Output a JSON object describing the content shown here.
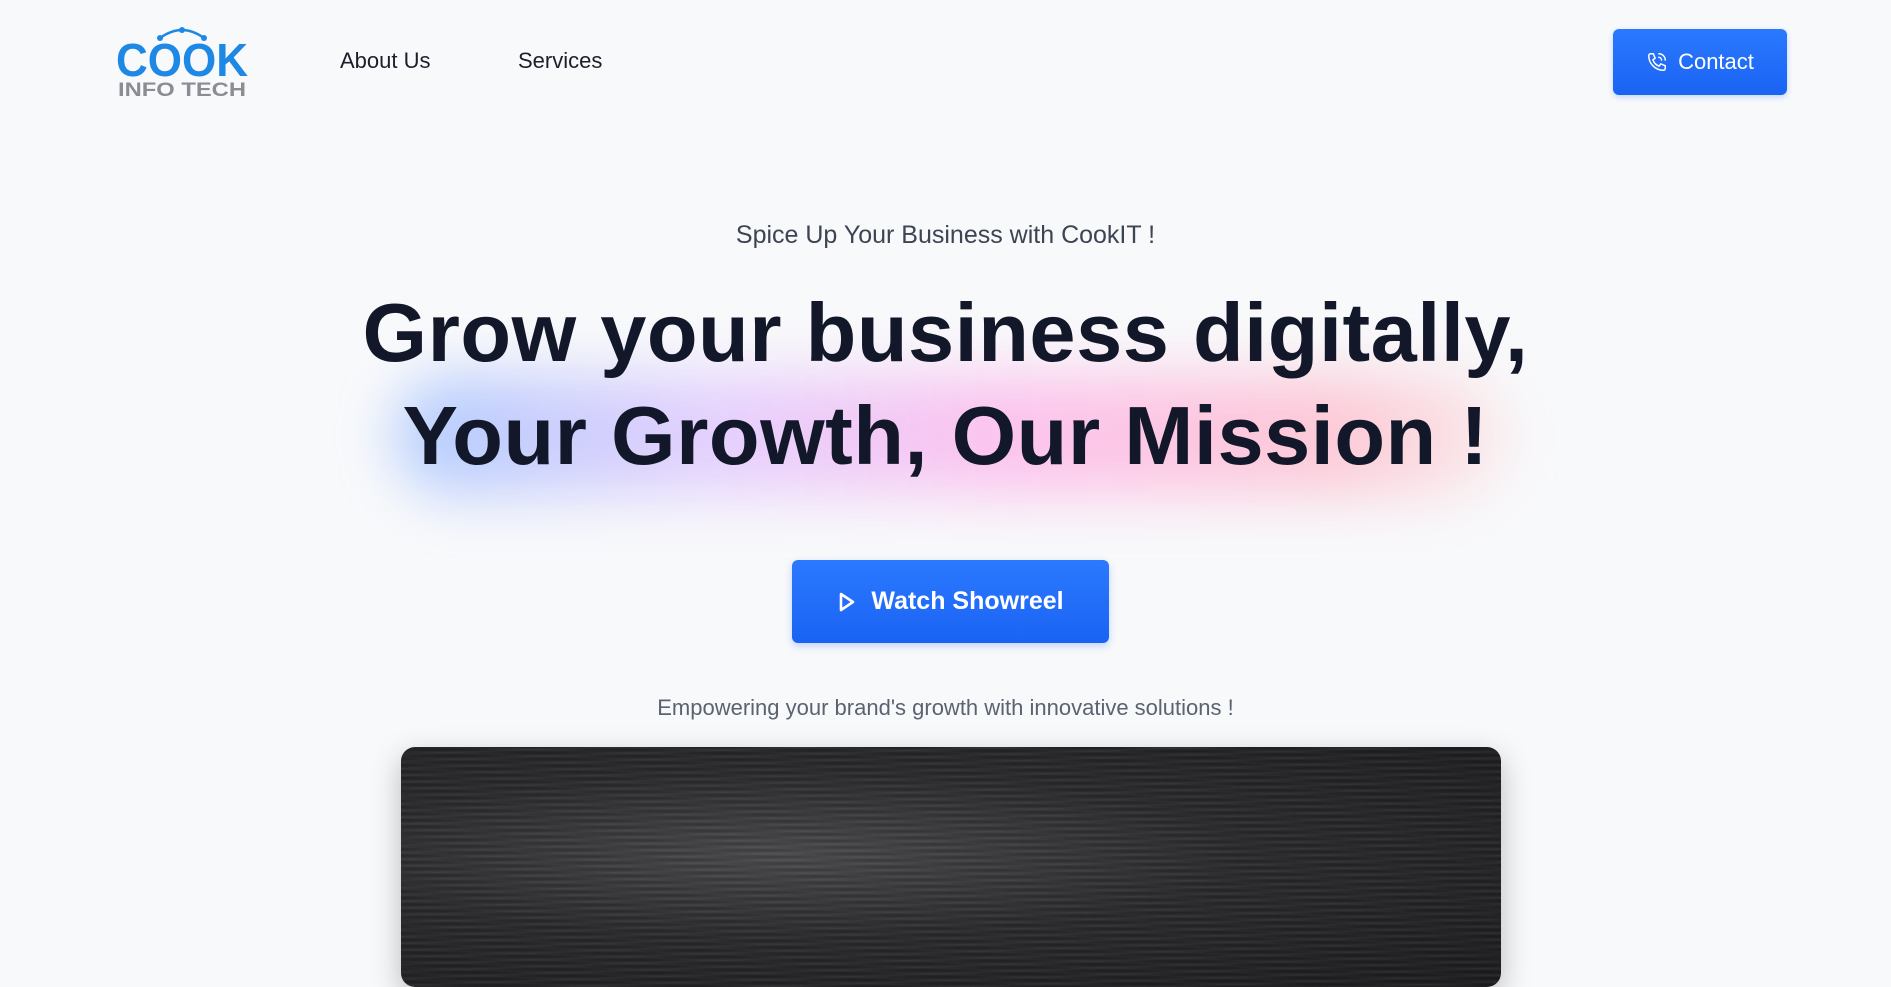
{
  "header": {
    "logo": {
      "top_text": "COOK",
      "bottom_text": "INFO TECH"
    },
    "nav": [
      {
        "label": "About Us"
      },
      {
        "label": "Services"
      }
    ],
    "contact_label": "Contact"
  },
  "hero": {
    "tagline": "Spice Up Your Business with CookIT !",
    "headline_line1": "Grow your business digitally,",
    "headline_line2": "Your Growth, Our Mission !",
    "cta_label": "Watch Showreel",
    "subtext": "Empowering your brand's growth with innovative solutions !"
  },
  "colors": {
    "primary": "#1a63f3",
    "background": "#f8f9fb",
    "heading": "#121829",
    "logo_blue": "#1e88e5",
    "logo_gray": "#8a8d92"
  },
  "icons": {
    "contact": "phone-icon",
    "cta": "play-icon"
  }
}
